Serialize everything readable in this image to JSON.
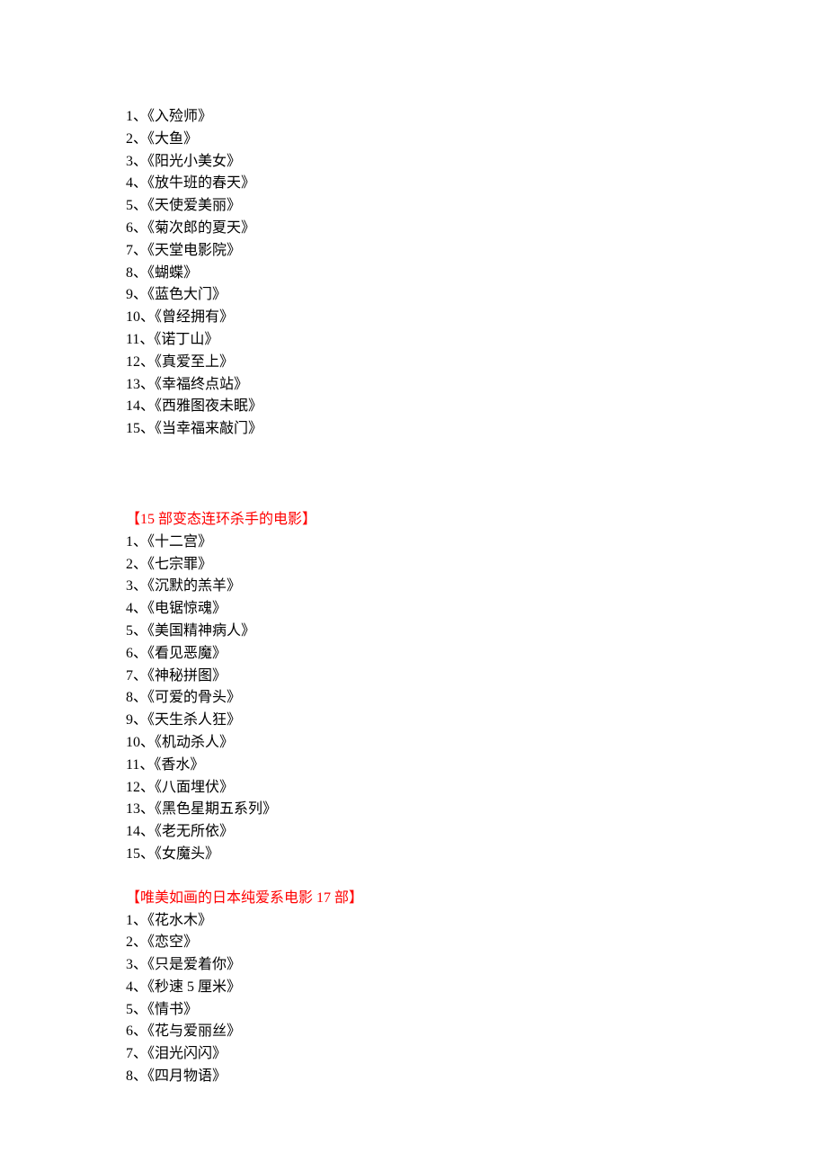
{
  "sections": [
    {
      "title": null,
      "items": [
        "1、《入殓师》",
        "2、《大鱼》",
        "3、《阳光小美女》",
        "4、《放牛班的春天》",
        "5、《天使爱美丽》",
        "6、《菊次郎的夏天》",
        "7、《天堂电影院》",
        "8、《蝴蝶》",
        "9、《蓝色大门》",
        "10、《曾经拥有》",
        "11、《诺丁山》",
        "12、《真爱至上》",
        "13、《幸福终点站》",
        "14、《西雅图夜未眠》",
        "15、《当幸福来敲门》"
      ],
      "spacer": "large"
    },
    {
      "title": "【15 部变态连环杀手的电影】",
      "items": [
        "1、《十二宫》",
        "2、《七宗罪》",
        "3、《沉默的羔羊》",
        "4、《电锯惊魂》",
        "5、《美国精神病人》",
        "6、《看见恶魔》",
        "7、《神秘拼图》",
        "8、《可爱的骨头》",
        "9、《天生杀人狂》",
        "10、《机动杀人》",
        "11、《香水》",
        "12、《八面埋伏》",
        "13、《黑色星期五系列》",
        "14、《老无所依》",
        "15、《女魔头》"
      ],
      "spacer": "small"
    },
    {
      "title": "【唯美如画的日本纯爱系电影 17 部】",
      "items": [
        "1、《花水木》",
        "2、《恋空》",
        "3、《只是爱着你》",
        "4、《秒速 5 厘米》",
        "5、《情书》",
        "6、《花与爱丽丝》",
        "7、《泪光闪闪》",
        "8、《四月物语》"
      ],
      "spacer": null
    }
  ]
}
